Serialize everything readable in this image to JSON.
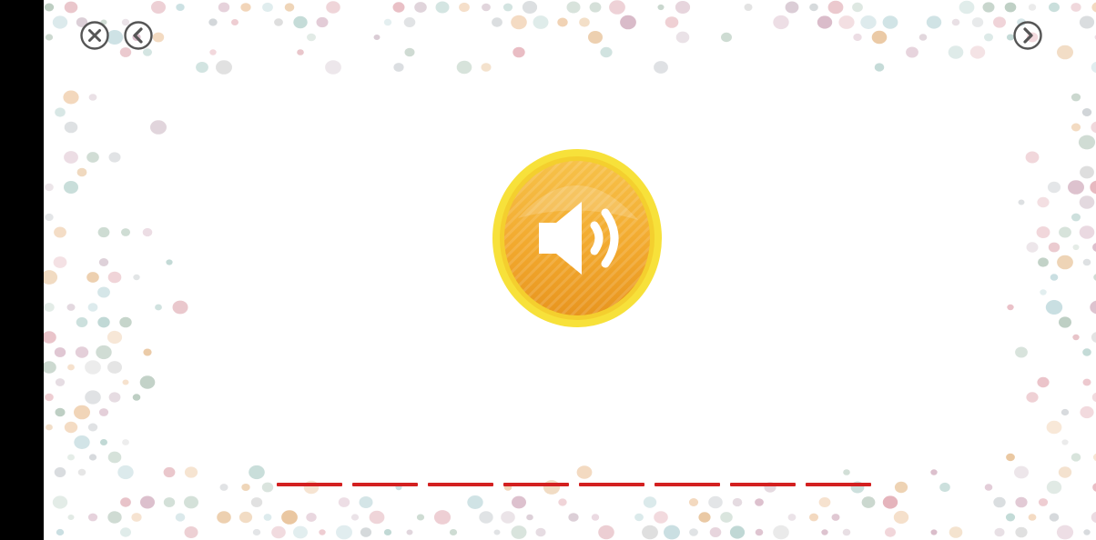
{
  "game": {
    "answer_slots": 8,
    "colors": {
      "slot_line": "#d32020",
      "sound_button_fill": "#f2a92e",
      "sound_button_rim": "#f7e13a",
      "nav_icon": "#555555"
    }
  },
  "controls": {
    "close_icon": "close-icon",
    "back_icon": "back-arrow-icon",
    "next_icon": "next-arrow-icon",
    "sound_icon": "speaker-icon"
  }
}
